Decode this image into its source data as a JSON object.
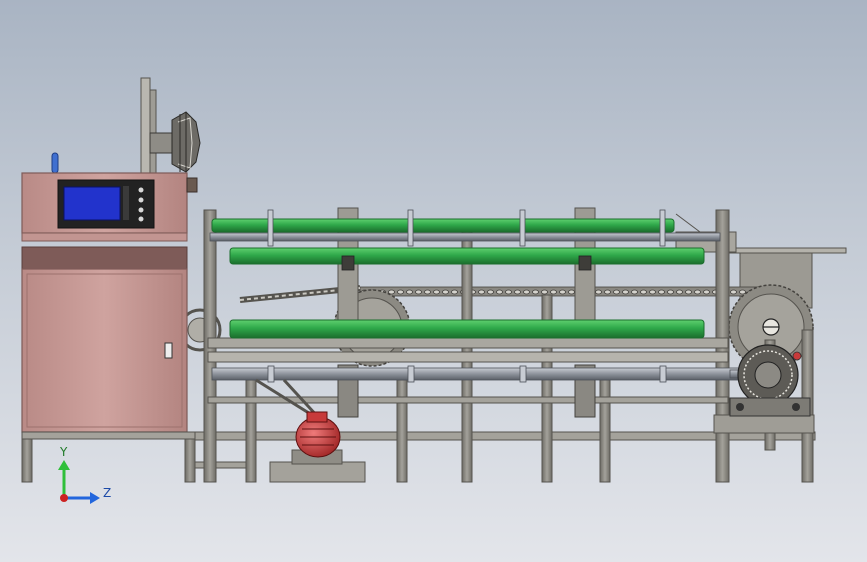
{
  "viewport": {
    "background_top": "#a9b4c3",
    "background_bottom": "#e3e5ea"
  },
  "colors": {
    "frame": "#8f8d86",
    "frame_dark": "#55534e",
    "cabinet": "#c79a96",
    "cabinet_dark": "#7e5b58",
    "roller": "#2fa84a",
    "roller_dark": "#1b6e2d",
    "shaft": "#8d929b",
    "motor": "#c73a3a",
    "screen": "#2233cc",
    "knob": "#3f6fd0"
  },
  "parts": {
    "control_cabinet": "control-cabinet",
    "touch_screen": "touch-screen",
    "wire_reel": "wire-reel",
    "green_rollers": 3,
    "drive_motor": "drive-motor",
    "chain": "drive-chain",
    "sprocket": "sprocket"
  },
  "triad": {
    "y_label": "Y",
    "z_label": "Z",
    "y_color": "#2fbf3a",
    "z_color": "#2266dd",
    "origin_color": "#cc2222"
  }
}
